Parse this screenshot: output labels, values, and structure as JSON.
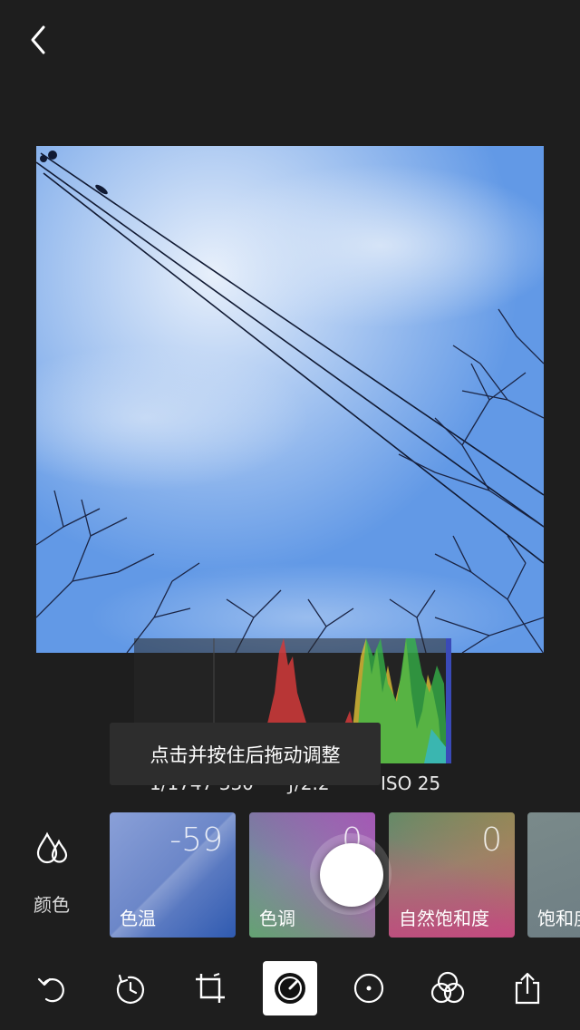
{
  "histogram_tooltip": "点击并按住后拖动调整",
  "exif": {
    "shutter": "1/1747 330",
    "aperture": "ƒ/2.2",
    "iso": "ISO 25"
  },
  "category": {
    "label": "颜色",
    "icon": "drops-icon"
  },
  "adjustments": [
    {
      "name": "色温",
      "value": "-59"
    },
    {
      "name": "色调",
      "value": "0"
    },
    {
      "name": "自然饱和度",
      "value": "0"
    },
    {
      "name": "饱和度",
      "value": ""
    }
  ],
  "toolbar": {
    "items": [
      {
        "icon": "undo-icon"
      },
      {
        "icon": "revert-icon"
      },
      {
        "icon": "crop-icon"
      },
      {
        "icon": "adjust-dial-icon",
        "active": true
      },
      {
        "icon": "selective-icon"
      },
      {
        "icon": "filters-icon"
      },
      {
        "icon": "share-icon"
      }
    ]
  },
  "colors": {
    "background": "#1e1e1e",
    "sky": "#5f96e4",
    "active_tool_bg": "#ffffff"
  }
}
